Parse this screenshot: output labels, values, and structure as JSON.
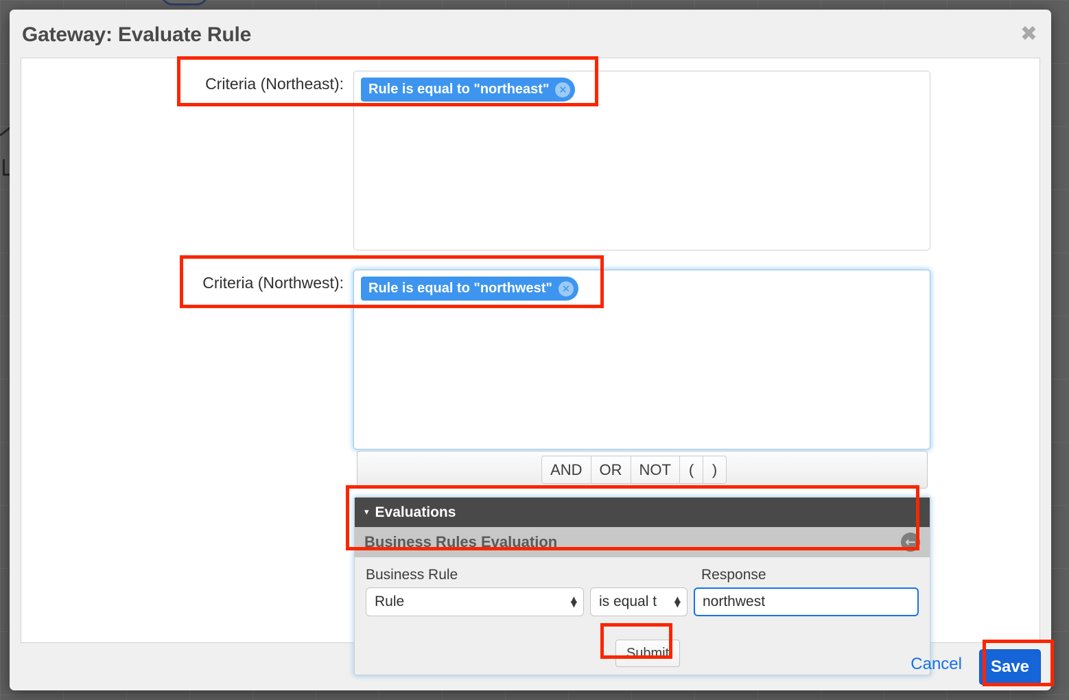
{
  "modal": {
    "title": "Gateway: Evaluate Rule",
    "close_icon": "close-icon"
  },
  "criteria": [
    {
      "label": "Criteria (Northeast):",
      "pill_text": "Rule is equal to \"northeast\"",
      "pill_remove_icon": "✕",
      "focused": false
    },
    {
      "label": "Criteria (Northwest):",
      "pill_text": "Rule is equal to \"northwest\"",
      "pill_remove_icon": "✕",
      "focused": true
    }
  ],
  "operators": [
    {
      "label": "AND"
    },
    {
      "label": "OR"
    },
    {
      "label": "NOT"
    },
    {
      "label": "("
    },
    {
      "label": ")"
    }
  ],
  "evaluations": {
    "header_label": "Evaluations",
    "caret_icon": "▾",
    "subheader_label": "Business Rules Evaluation",
    "back_icon": "←",
    "field_labels": {
      "business_rule": "Business Rule",
      "response": "Response"
    },
    "business_rule_value": "Rule",
    "operator_value": "is equal t",
    "response_value": "northwest",
    "response_placeholder": "",
    "submit_label": "Submit",
    "stepper_up": "▲",
    "stepper_down": "▼"
  },
  "footer": {
    "cancel_label": "Cancel",
    "save_label": "Save"
  },
  "colors": {
    "accent_blue": "#3d95ef",
    "save_blue": "#1565d8",
    "highlight_red": "#fa2600",
    "eval_header_gray": "#494949",
    "eval_subheader_gray": "#c8c8c8"
  }
}
